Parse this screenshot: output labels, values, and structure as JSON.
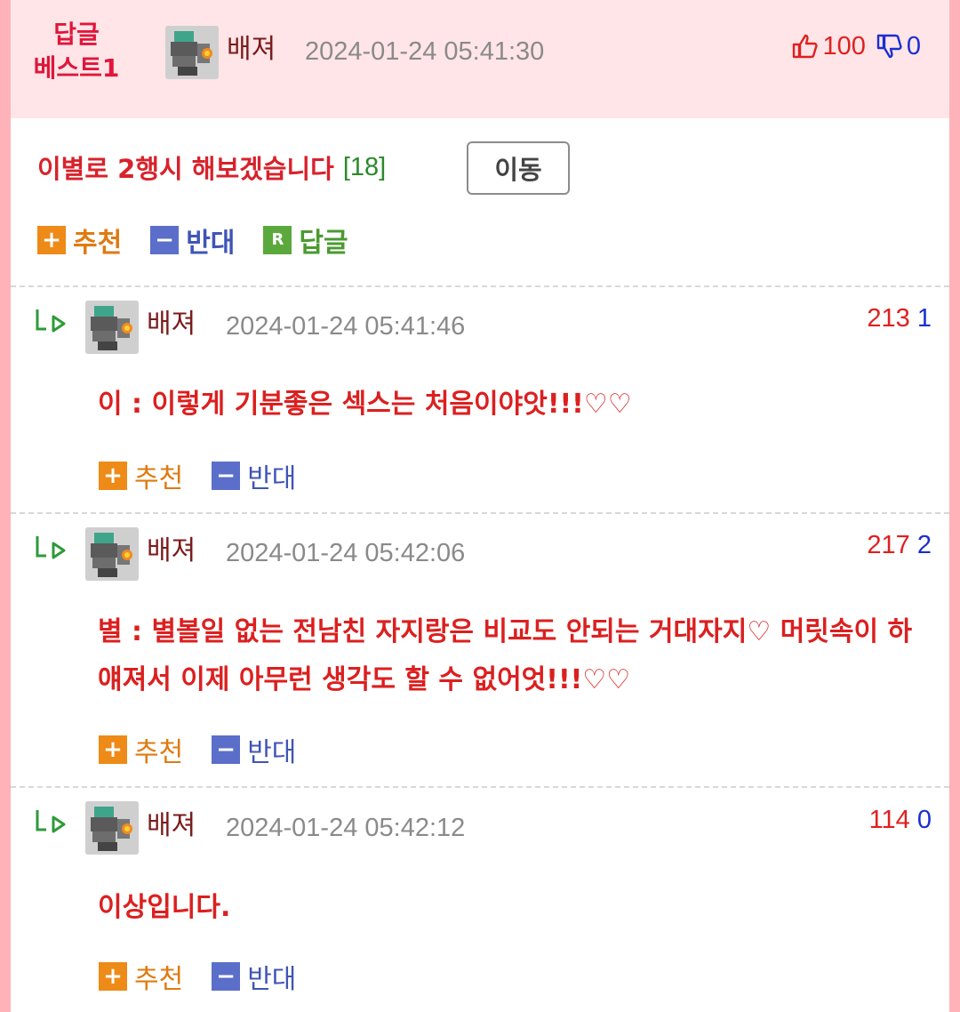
{
  "header": {
    "best_label_line1": "답글",
    "best_label_line2": "베스트1",
    "author": "배져",
    "datetime": "2024-01-24 05:41:30",
    "upvotes": "100",
    "downvotes": "0"
  },
  "post": {
    "title": "이별로 2행시 해보겠습니다",
    "reply_count": "[18]",
    "move_button": "이동"
  },
  "actions": {
    "recommend": "추천",
    "oppose": "반대",
    "reply": "답글",
    "reply_badge": "R"
  },
  "comments": [
    {
      "author": "배져",
      "datetime": "2024-01-24 05:41:46",
      "up": "213",
      "down": "1",
      "text": "이 : 이렇게 기분좋은 섹스는 처음이야앗!!!♡♡"
    },
    {
      "author": "배져",
      "datetime": "2024-01-24 05:42:06",
      "up": "217",
      "down": "2",
      "text": "별 : 별볼일 없는 전남친 자지랑은 비교도 안되는 거대자지♡ 머릿속이 하얘져서 이제 아무런 생각도 할 수 없어엇!!!♡♡"
    },
    {
      "author": "배져",
      "datetime": "2024-01-24 05:42:12",
      "up": "114",
      "down": "0",
      "text": "이상입니다."
    }
  ],
  "colors": {
    "accent_red": "#d8222b",
    "header_bg": "#ffe5e7",
    "page_border": "#ffb3b8",
    "recommend": "#ee8a17",
    "oppose": "#5b6ec9",
    "reply": "#5ba93d"
  },
  "icons": [
    "thumbs-up-icon",
    "thumbs-down-icon",
    "reply-arrow-icon",
    "plus-icon",
    "minus-icon",
    "r-icon",
    "robot-avatar"
  ]
}
